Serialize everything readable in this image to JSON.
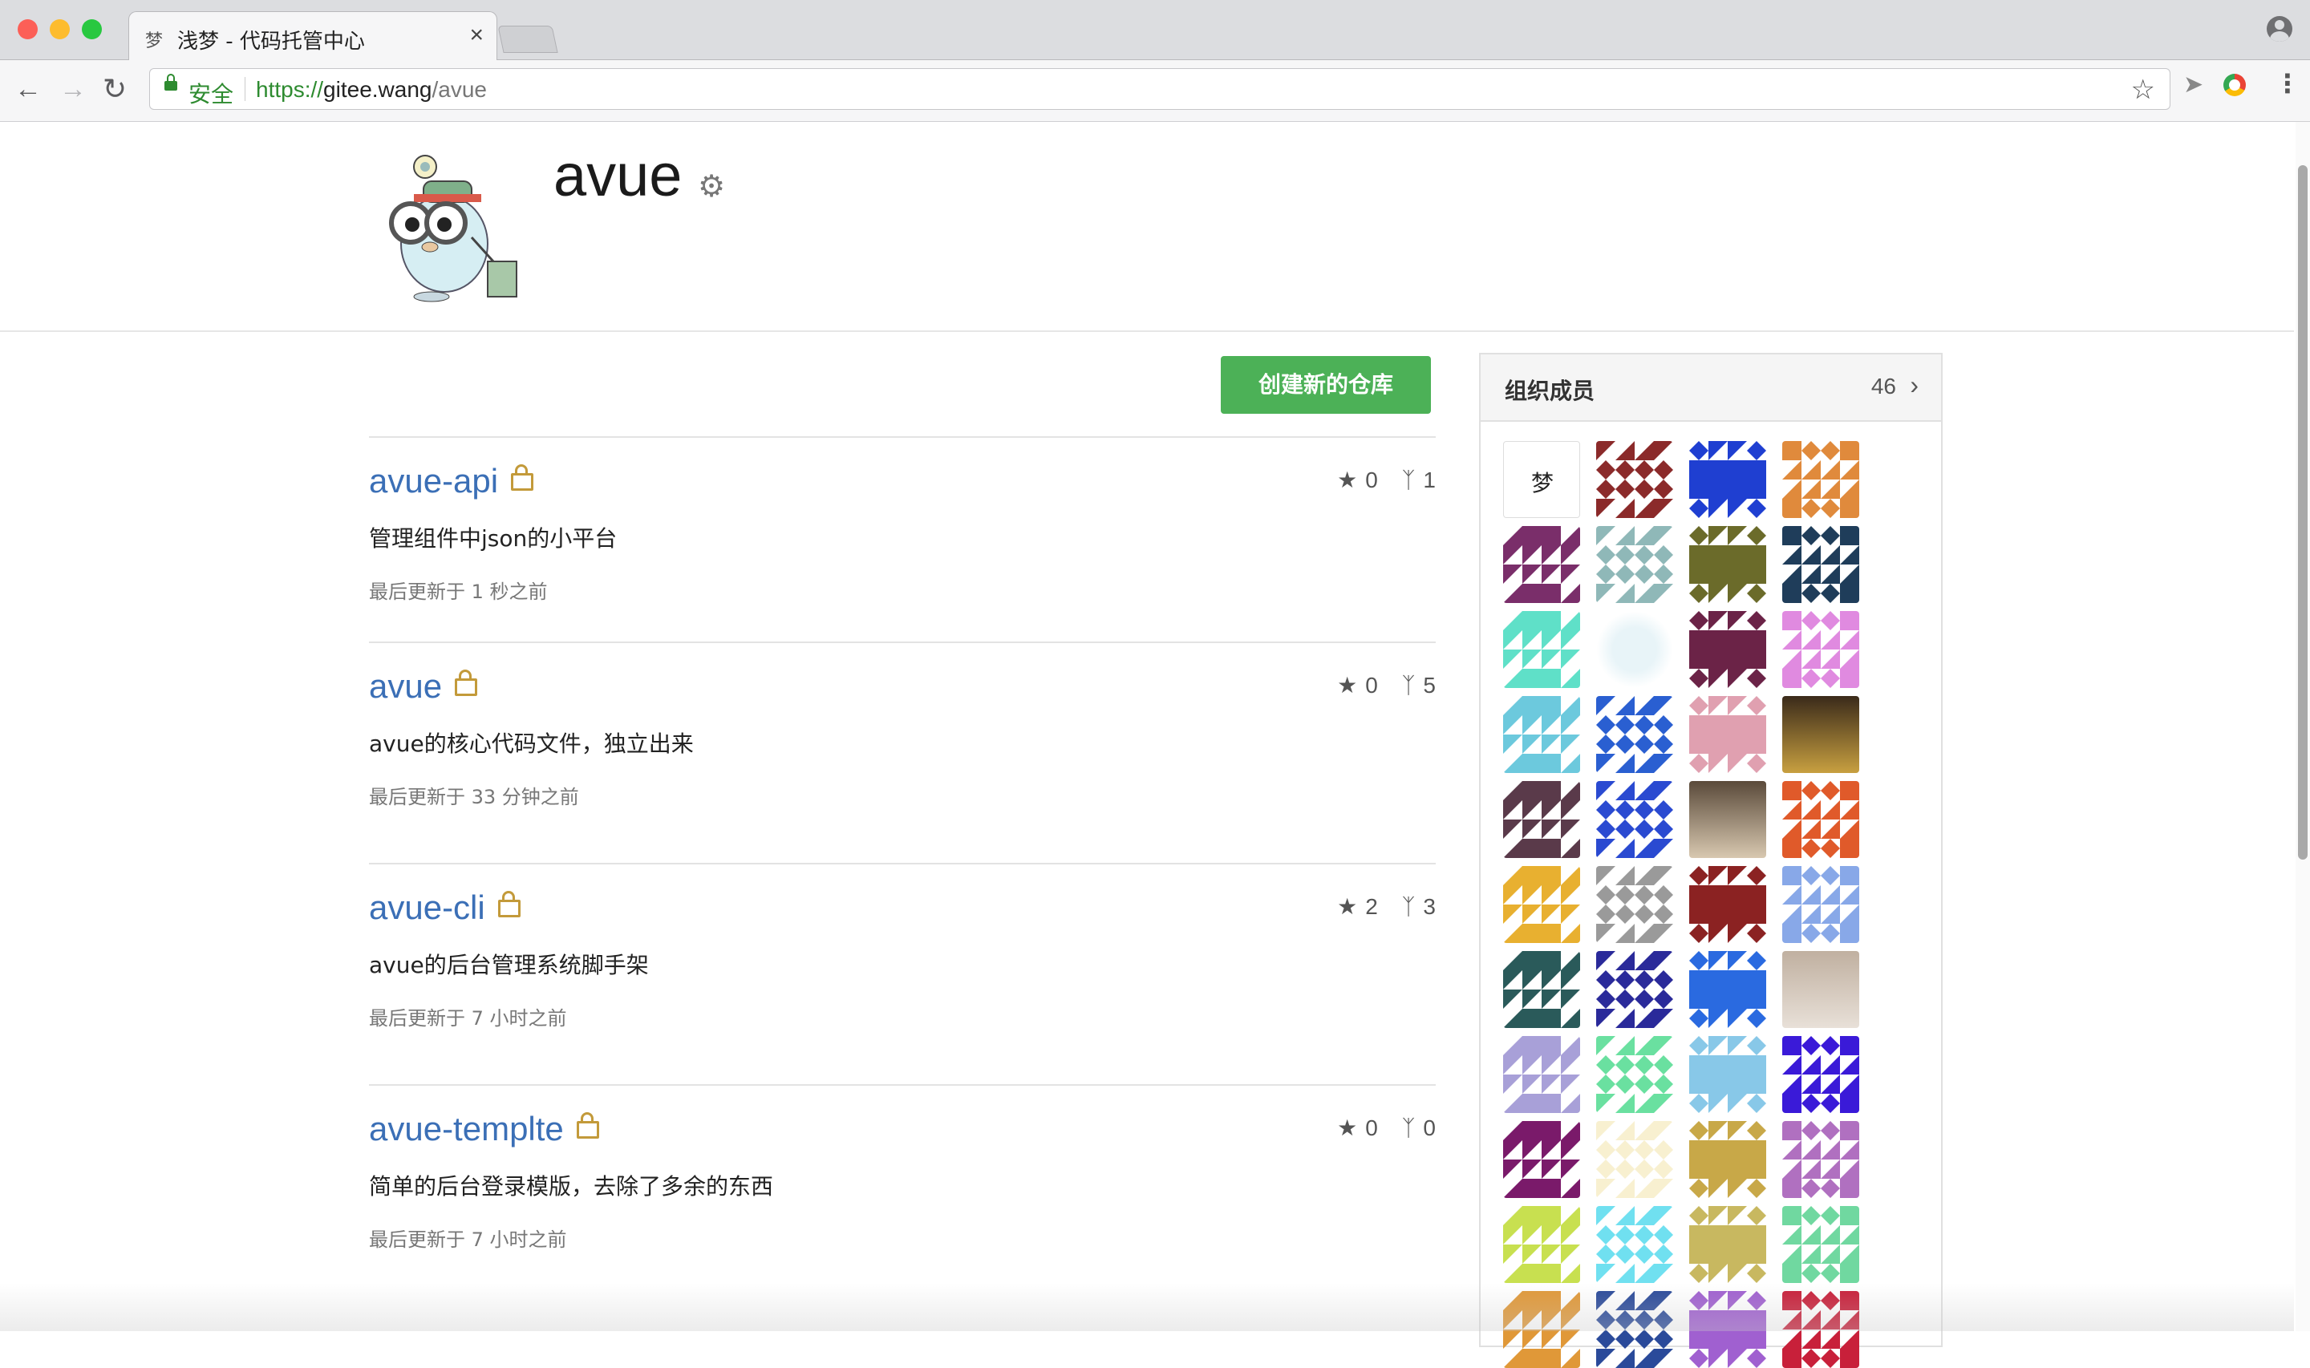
{
  "browser": {
    "tab_title": "浅梦 - 代码托管中心",
    "tab_favicon": "梦",
    "tab_close": "×",
    "secure_label": "安全",
    "url_scheme": "https://",
    "url_host": "gitee.wang",
    "url_path": "/avue"
  },
  "org": {
    "name": "avue",
    "avatar_icon": "go-gopher-mascot-avatar",
    "settings_icon": "gear-icon"
  },
  "actions": {
    "create_repo_label": "创建新的仓库"
  },
  "repos": [
    {
      "name": "avue-api",
      "description": "管理组件中json的小平台",
      "updated": "最后更新于 1 秒之前",
      "stars": "0",
      "forks": "1"
    },
    {
      "name": "avue",
      "description": "avue的核心代码文件，独立出来",
      "updated": "最后更新于 33 分钟之前",
      "stars": "0",
      "forks": "5"
    },
    {
      "name": "avue-cli",
      "description": "avue的后台管理系统脚手架",
      "updated": "最后更新于 7 小时之前",
      "stars": "2",
      "forks": "3"
    },
    {
      "name": "avue-templte",
      "description": "简单的后台登录模版，去除了多余的东西",
      "updated": "最后更新于 7 小时之前",
      "stars": "0",
      "forks": "0"
    }
  ],
  "members_panel": {
    "title": "组织成员",
    "count": "46",
    "first_avatar_text": "梦",
    "colors": [
      "#ffffff",
      "#8b2a2a",
      "#1f3fd1",
      "#e08a3c",
      "#7a2e6a",
      "#8fb8b8",
      "#6b6b2a",
      "#1f3d5a",
      "#5fe0c8",
      "#gopher",
      "#6b2347",
      "#e08ae0",
      "#6cc9dd",
      "#2a5fd1",
      "#e0a0b0",
      "#photo1",
      "#5a3a4a",
      "#2a4ad1",
      "#photo2",
      "#e05a2a",
      "#e8b030",
      "#9a9a9a",
      "#8b2222",
      "#88a8e8",
      "#2a5a5a",
      "#2a2a9a",
      "#2a6ae0",
      "#photo3",
      "#a8a0d8",
      "#6ae0a0",
      "#88c8e8",
      "#3a1ad8",
      "#7a1a6a",
      "#f8f0d0",
      "#c8a848",
      "#b070c0",
      "#c8e050",
      "#70e0f0",
      "#c8b860",
      "#70d8a0",
      "#e09838",
      "#2a4a9a",
      "#a060d0",
      "#c8203a"
    ]
  }
}
